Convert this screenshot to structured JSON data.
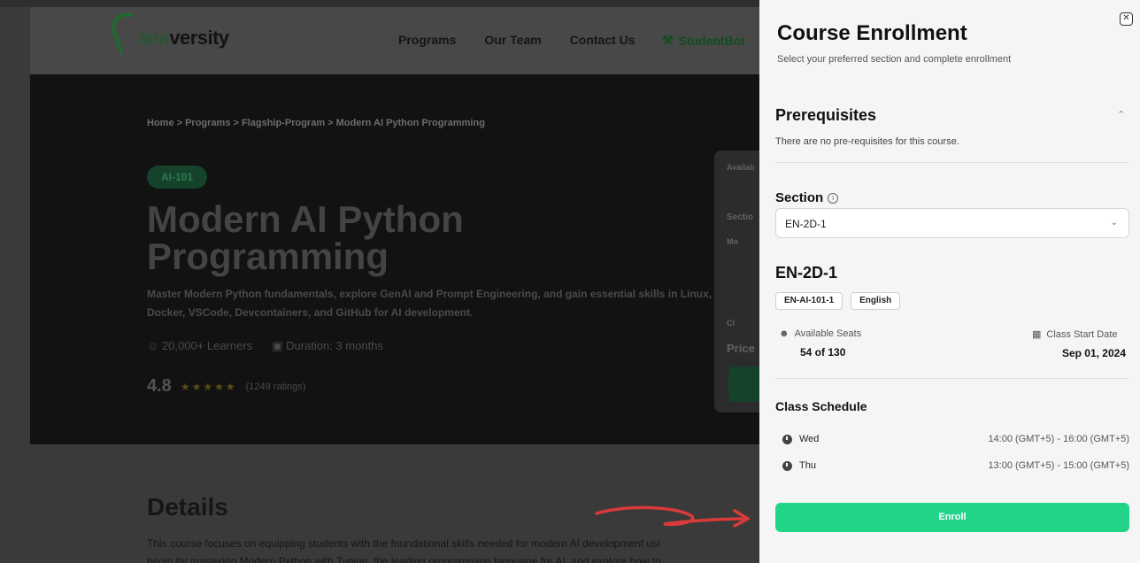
{
  "nav": {
    "logo_text_light": "ana",
    "logo_text_bold": "versity",
    "links": [
      "Programs",
      "Our Team",
      "Contact Us"
    ],
    "studentbot": "StudentBot"
  },
  "hero": {
    "breadcrumb": "Home > Programs > Flagship-Program > Modern AI Python Programming",
    "badge": "AI-101",
    "title": "Modern AI Python Programming",
    "description": "Master Modern Python fundamentals, explore GenAI and Prompt Engineering, and gain essential skills in Linux, Docker, VSCode, Devcontainers, and GitHub for AI development.",
    "learners": "20,000+ Learners",
    "duration": "Duration: 3 months",
    "rating": "4.8",
    "ratings_count": "(1249 ratings)",
    "side_card": {
      "available": "Availab",
      "section": "Sectio",
      "mo": "Mo",
      "cl": "Cl",
      "price": "Price"
    }
  },
  "details": {
    "title": "Details",
    "line1": "This course focuses on equipping students with the foundational skills needed for modern AI development usi",
    "line2": "begin by mastering Modern Python with Typing, the leading programming language for AI, and explore how to"
  },
  "drawer": {
    "title": "Course Enrollment",
    "subtitle": "Select your preferred section and complete enrollment",
    "prereq_heading": "Prerequisites",
    "prereq_text": "There are no pre-requisites for this course.",
    "section_label": "Section",
    "selected_section": "EN-2D-1",
    "section_name": "EN-2D-1",
    "tags": [
      "EN-AI-101-1",
      "English"
    ],
    "seats_label": "Available Seats",
    "seats_value": "54 of 130",
    "start_label": "Class Start Date",
    "start_value": "Sep 01, 2024",
    "schedule_title": "Class Schedule",
    "schedule": [
      {
        "day": "Wed",
        "time": "14:00 (GMT+5) - 16:00 (GMT+5)"
      },
      {
        "day": "Thu",
        "time": "13:00 (GMT+5) - 15:00 (GMT+5)"
      }
    ],
    "enroll_label": "Enroll"
  },
  "colors": {
    "accent": "#22d488",
    "annotation_arrow": "#d93a3a"
  }
}
